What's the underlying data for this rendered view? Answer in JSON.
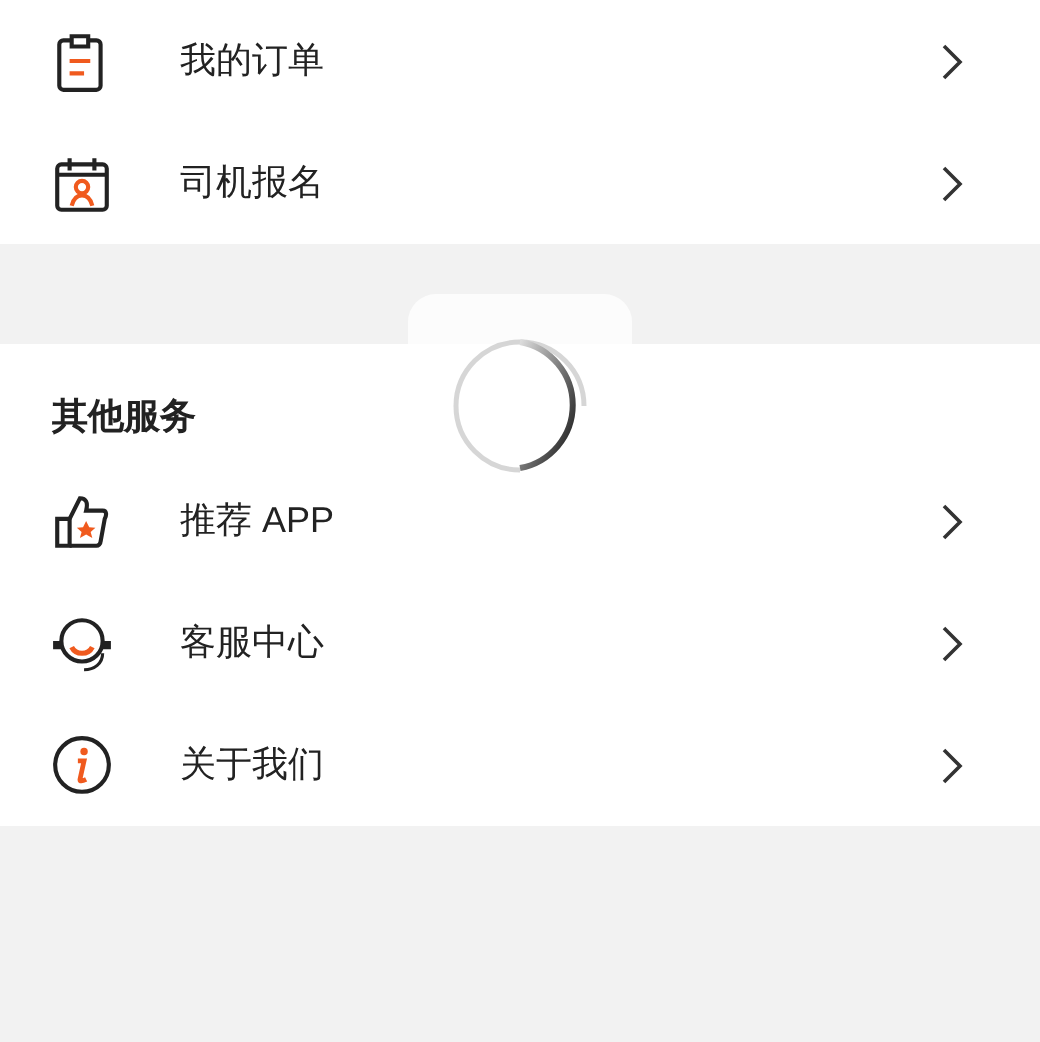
{
  "sections": [
    {
      "items": [
        {
          "kind": "order",
          "label": "我的订单"
        },
        {
          "kind": "driver",
          "label": "司机报名"
        }
      ]
    },
    {
      "title": "其他服务",
      "items": [
        {
          "kind": "recommend",
          "label": "推荐 APP"
        },
        {
          "kind": "service",
          "label": "客服中心"
        },
        {
          "kind": "about",
          "label": "关于我们"
        }
      ]
    }
  ],
  "loading": {
    "kind": "spinner"
  }
}
